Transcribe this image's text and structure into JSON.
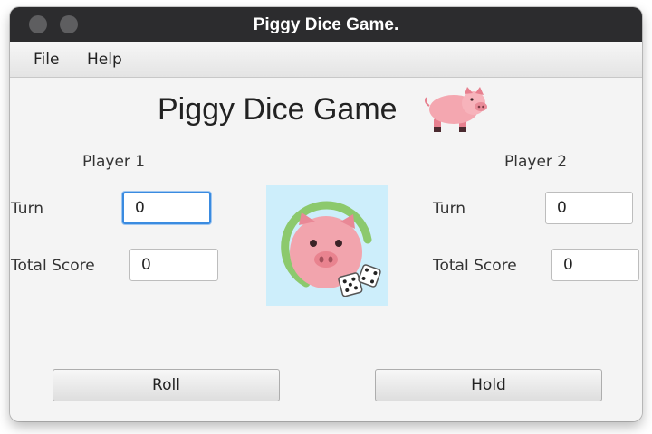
{
  "window": {
    "title": "Piggy Dice Game."
  },
  "menu": {
    "items": [
      "File",
      "Help"
    ]
  },
  "main": {
    "heading": "Piggy Dice Game",
    "heading_icon": "pig-icon",
    "center_image": "pig-with-dice-icon"
  },
  "player1": {
    "name": "Player 1",
    "turn_label": "Turn",
    "turn_value": "0",
    "total_label": "Total Score",
    "total_value": "0"
  },
  "player2": {
    "name": "Player 2",
    "turn_label": "Turn",
    "turn_value": "0",
    "total_label": "Total Score",
    "total_value": "0"
  },
  "buttons": {
    "roll": "Roll",
    "hold": "Hold"
  },
  "colors": {
    "titlebar": "#2c2c2e",
    "focus": "#3a8be0",
    "logo_bg": "#cdeefb",
    "pig_pink": "#f4a7b0"
  }
}
